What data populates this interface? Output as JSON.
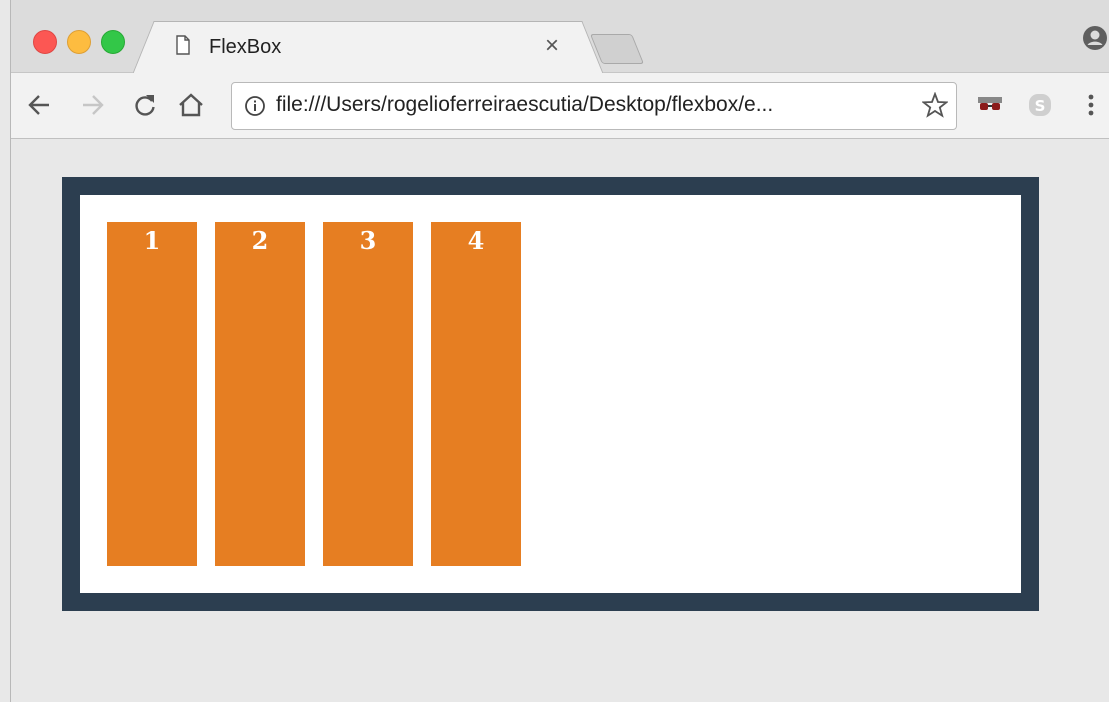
{
  "browser": {
    "tab": {
      "title": "FlexBox",
      "close_label": "×"
    },
    "address_bar": {
      "url": "file:///Users/rogelioferreiraescutia/Desktop/flexbox/e..."
    }
  },
  "icons": {
    "back": "arrow-left-icon",
    "forward": "arrow-right-icon",
    "reload": "reload-icon",
    "home": "home-icon",
    "info": "info-icon",
    "bookmark": "star-icon",
    "extension_1": "glasses-extension-icon",
    "extension_2": "skype-extension-icon",
    "menu": "kebab-menu-icon",
    "profile": "profile-icon",
    "page": "document-icon"
  },
  "page": {
    "container_border_color": "#2c3e50",
    "item_color": "#e67e22",
    "items": [
      "1",
      "2",
      "3",
      "4"
    ]
  }
}
